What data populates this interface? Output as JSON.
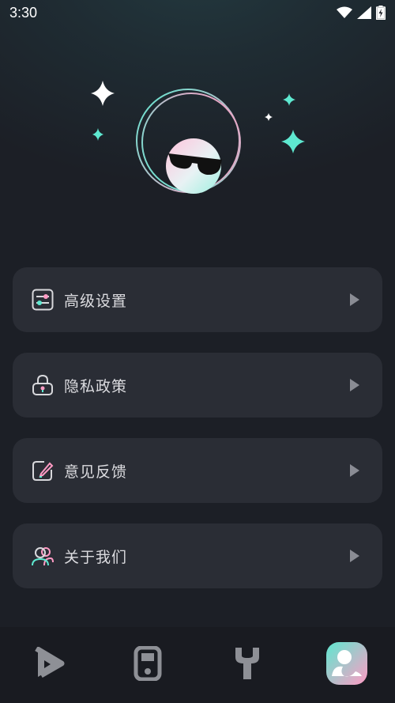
{
  "status": {
    "time": "3:30",
    "icons": [
      "wifi-icon",
      "signal-icon",
      "battery-charging-icon"
    ]
  },
  "hero": {
    "image": "mascot-with-sunglasses",
    "accent_colors": [
      "#5ee8d0",
      "#ff9bc4"
    ]
  },
  "menu": {
    "items": [
      {
        "label": "高级设置",
        "icon": "sliders-icon"
      },
      {
        "label": "隐私政策",
        "icon": "lock-icon"
      },
      {
        "label": "意见反馈",
        "icon": "edit-icon"
      },
      {
        "label": "关于我们",
        "icon": "users-icon"
      }
    ]
  },
  "bottom_nav": {
    "items": [
      {
        "icon": "play-icon",
        "active": false
      },
      {
        "icon": "phone-icon",
        "active": false
      },
      {
        "icon": "wrench-icon",
        "active": false
      },
      {
        "icon": "profile-icon",
        "active": true
      }
    ]
  },
  "colors": {
    "background": "#1c1f26",
    "card": "#2a2d35",
    "teal": "#5ee8d0",
    "pink": "#ff9bc4",
    "nav_bg": "#191b21"
  }
}
